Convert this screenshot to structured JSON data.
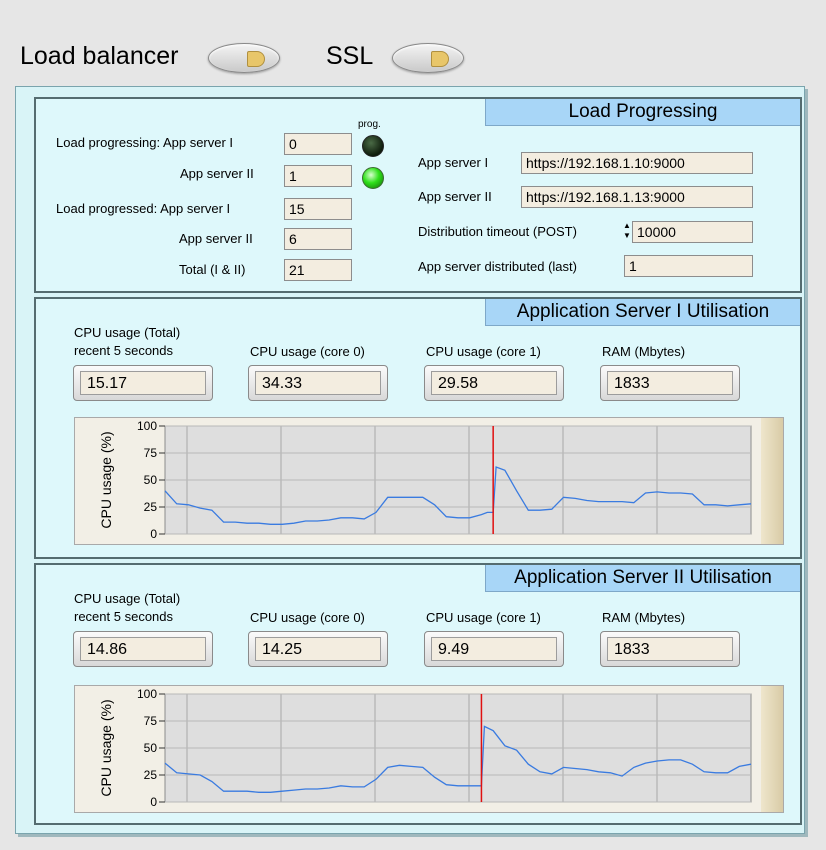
{
  "header": {
    "load_balancer_label": "Load balancer",
    "ssl_label": "SSL"
  },
  "load_progressing": {
    "title": "Load Progressing",
    "prog_label": "prog.",
    "progressing_app1_label": "Load progressing: App server I",
    "progressing_app1_value": "0",
    "progressing_app2_label": "App server II",
    "progressing_app2_value": "1",
    "progressed_app1_label": "Load progressed: App server I",
    "progressed_app1_value": "15",
    "progressed_app2_label": "App server II",
    "progressed_app2_value": "6",
    "total_label": "Total (I & II)",
    "total_value": "21",
    "app_server_1_label": "App server I",
    "app_server_1_url": "https://192.168.1.10:9000",
    "app_server_2_label": "App server II",
    "app_server_2_url": "https://192.168.1.13:9000",
    "distribution_timeout_label": "Distribution timeout (POST)",
    "distribution_timeout_value": "10000",
    "distributed_last_label": "App server distributed (last)",
    "distributed_last_value": "1",
    "led_app1": "off",
    "led_app2": "on"
  },
  "server1": {
    "title": "Application Server I Utilisation",
    "cpu_total_label_1": "CPU usage (Total)",
    "cpu_total_label_2": "recent 5 seconds",
    "cpu_total_value": "15.17",
    "cpu_core0_label": "CPU usage (core 0)",
    "cpu_core0_value": "34.33",
    "cpu_core1_label": "CPU usage (core 1)",
    "cpu_core1_value": "29.58",
    "ram_label": "RAM (Mbytes)",
    "ram_value": "1833"
  },
  "server2": {
    "title": "Application Server II Utilisation",
    "cpu_total_label_1": "CPU usage (Total)",
    "cpu_total_label_2": "recent 5 seconds",
    "cpu_total_value": "14.86",
    "cpu_core0_label": "CPU usage (core 0)",
    "cpu_core0_value": "14.25",
    "cpu_core1_label": "CPU usage (core 1)",
    "cpu_core1_value": "9.49",
    "ram_label": "RAM (Mbytes)",
    "ram_value": "1833"
  },
  "chart_data": [
    {
      "type": "line",
      "ylabel": "CPU usage (%)",
      "ylim": [
        0,
        100
      ],
      "yticks": [
        "100",
        "75",
        "50",
        "25",
        "0"
      ],
      "grid": true,
      "series_color": "#3a7be0",
      "marker_color": "#e01010",
      "marker_x": 56,
      "x": [
        0,
        2,
        4,
        6,
        8,
        10,
        12,
        14,
        16,
        18,
        20,
        22,
        24,
        26,
        28,
        30,
        32,
        34,
        36,
        38,
        40,
        42,
        44,
        46,
        48,
        50,
        52,
        54,
        55,
        56,
        56.5,
        58,
        60,
        62,
        64,
        66,
        68,
        70,
        72,
        74,
        76,
        78,
        80,
        82,
        84,
        86,
        88,
        90,
        92,
        94,
        96,
        98,
        100
      ],
      "values": [
        40,
        28,
        27,
        24,
        22,
        11,
        11,
        10,
        10,
        9,
        9,
        10,
        12,
        12,
        13,
        15,
        15,
        14,
        20,
        34,
        34,
        34,
        34,
        27,
        16,
        15,
        15,
        18,
        20,
        20,
        62,
        59,
        40,
        22,
        22,
        23,
        34,
        33,
        31,
        30,
        30,
        30,
        29,
        38,
        39,
        38,
        38,
        37,
        27,
        27,
        26,
        27,
        28
      ]
    },
    {
      "type": "line",
      "ylabel": "CPU usage (%)",
      "ylim": [
        0,
        100
      ],
      "yticks": [
        "100",
        "75",
        "50",
        "25",
        "0"
      ],
      "grid": true,
      "series_color": "#3a7be0",
      "marker_color": "#e01010",
      "marker_x": 54,
      "x": [
        0,
        2,
        4,
        6,
        8,
        10,
        12,
        14,
        16,
        18,
        20,
        22,
        24,
        26,
        28,
        30,
        32,
        34,
        36,
        38,
        40,
        42,
        44,
        46,
        48,
        50,
        52,
        53.5,
        54,
        54.5,
        56,
        58,
        60,
        62,
        64,
        66,
        68,
        70,
        72,
        74,
        76,
        78,
        80,
        82,
        84,
        86,
        88,
        90,
        92,
        94,
        96,
        98,
        100
      ],
      "values": [
        36,
        27,
        26,
        25,
        19,
        10,
        10,
        10,
        9,
        9,
        10,
        11,
        12,
        12,
        13,
        15,
        14,
        14,
        21,
        32,
        34,
        33,
        32,
        23,
        16,
        15,
        15,
        15,
        15,
        70,
        66,
        52,
        48,
        35,
        28,
        26,
        32,
        31,
        30,
        28,
        27,
        24,
        32,
        36,
        38,
        39,
        39,
        35,
        28,
        27,
        27,
        33,
        35
      ]
    }
  ]
}
